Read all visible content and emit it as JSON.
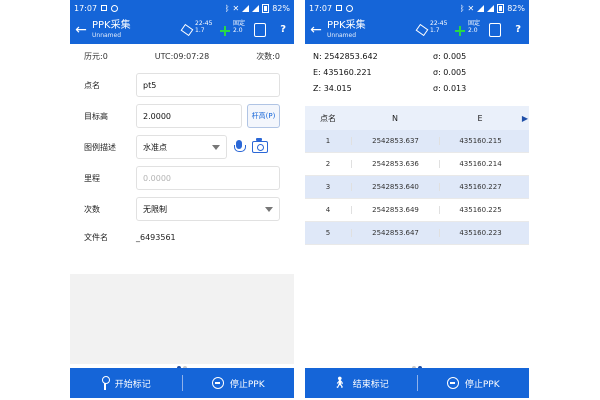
{
  "status_bar": {
    "time": "17:07",
    "battery": "82%"
  },
  "app_bar": {
    "title": "PPK采集",
    "subtitle": "Unnamed",
    "sat_count": "22-45",
    "sat_value": "1.7",
    "fix_label": "固定",
    "fix_value": "2.0",
    "help": "?"
  },
  "left": {
    "epoch_label": "历元:0",
    "utc": "UTC:09:07:28",
    "count_label": "次数:0",
    "fields": {
      "point_name": {
        "label": "点名",
        "value": "pt5"
      },
      "target_height": {
        "label": "目标高",
        "value": "2.0000",
        "button": "杆高(P)"
      },
      "legend": {
        "label": "图例描述",
        "value": "水准点"
      },
      "mileage": {
        "label": "里程",
        "placeholder": "0.0000"
      },
      "times": {
        "label": "次数",
        "value": "无限制"
      },
      "filename": {
        "label": "文件名",
        "value": "_6493561"
      }
    },
    "bottom": {
      "start": "开始标记",
      "stop": "停止PPK"
    }
  },
  "right": {
    "coords": {
      "N": "N:  2542853.642",
      "sN": "σ:  0.005",
      "E": "E:  435160.221",
      "sE": "σ:  0.005",
      "Z": "Z:  34.015",
      "sZ": "σ:  0.013"
    },
    "table": {
      "headers": [
        "点名",
        "N",
        "E"
      ],
      "rows": [
        [
          "1",
          "2542853.637",
          "435160.215"
        ],
        [
          "2",
          "2542853.636",
          "435160.214"
        ],
        [
          "3",
          "2542853.640",
          "435160.227"
        ],
        [
          "4",
          "2542853.649",
          "435160.225"
        ],
        [
          "5",
          "2542853.647",
          "435160.223"
        ]
      ]
    },
    "bottom": {
      "end": "结束标记",
      "stop": "停止PPK"
    }
  }
}
